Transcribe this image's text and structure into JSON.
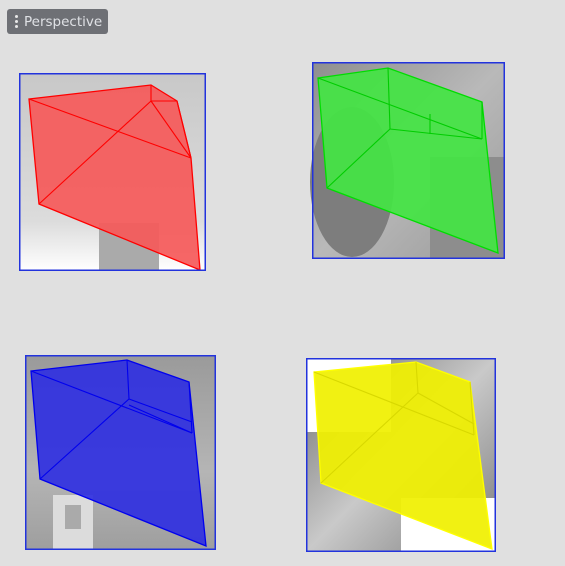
{
  "viewport": {
    "menu_label": "Perspective",
    "menu_icon": "vertical-dots-icon"
  },
  "panels": [
    {
      "name": "red-viewport",
      "color": "#ff0000",
      "fill": "#f55a5a"
    },
    {
      "name": "green-viewport",
      "color": "#00dd00",
      "fill": "#44e444"
    },
    {
      "name": "blue-viewport",
      "color": "#0000ee",
      "fill": "#3030e0"
    },
    {
      "name": "yellow-viewport",
      "color": "#ffff00",
      "fill": "#f0f000"
    }
  ],
  "frame_color": "#2233dd"
}
